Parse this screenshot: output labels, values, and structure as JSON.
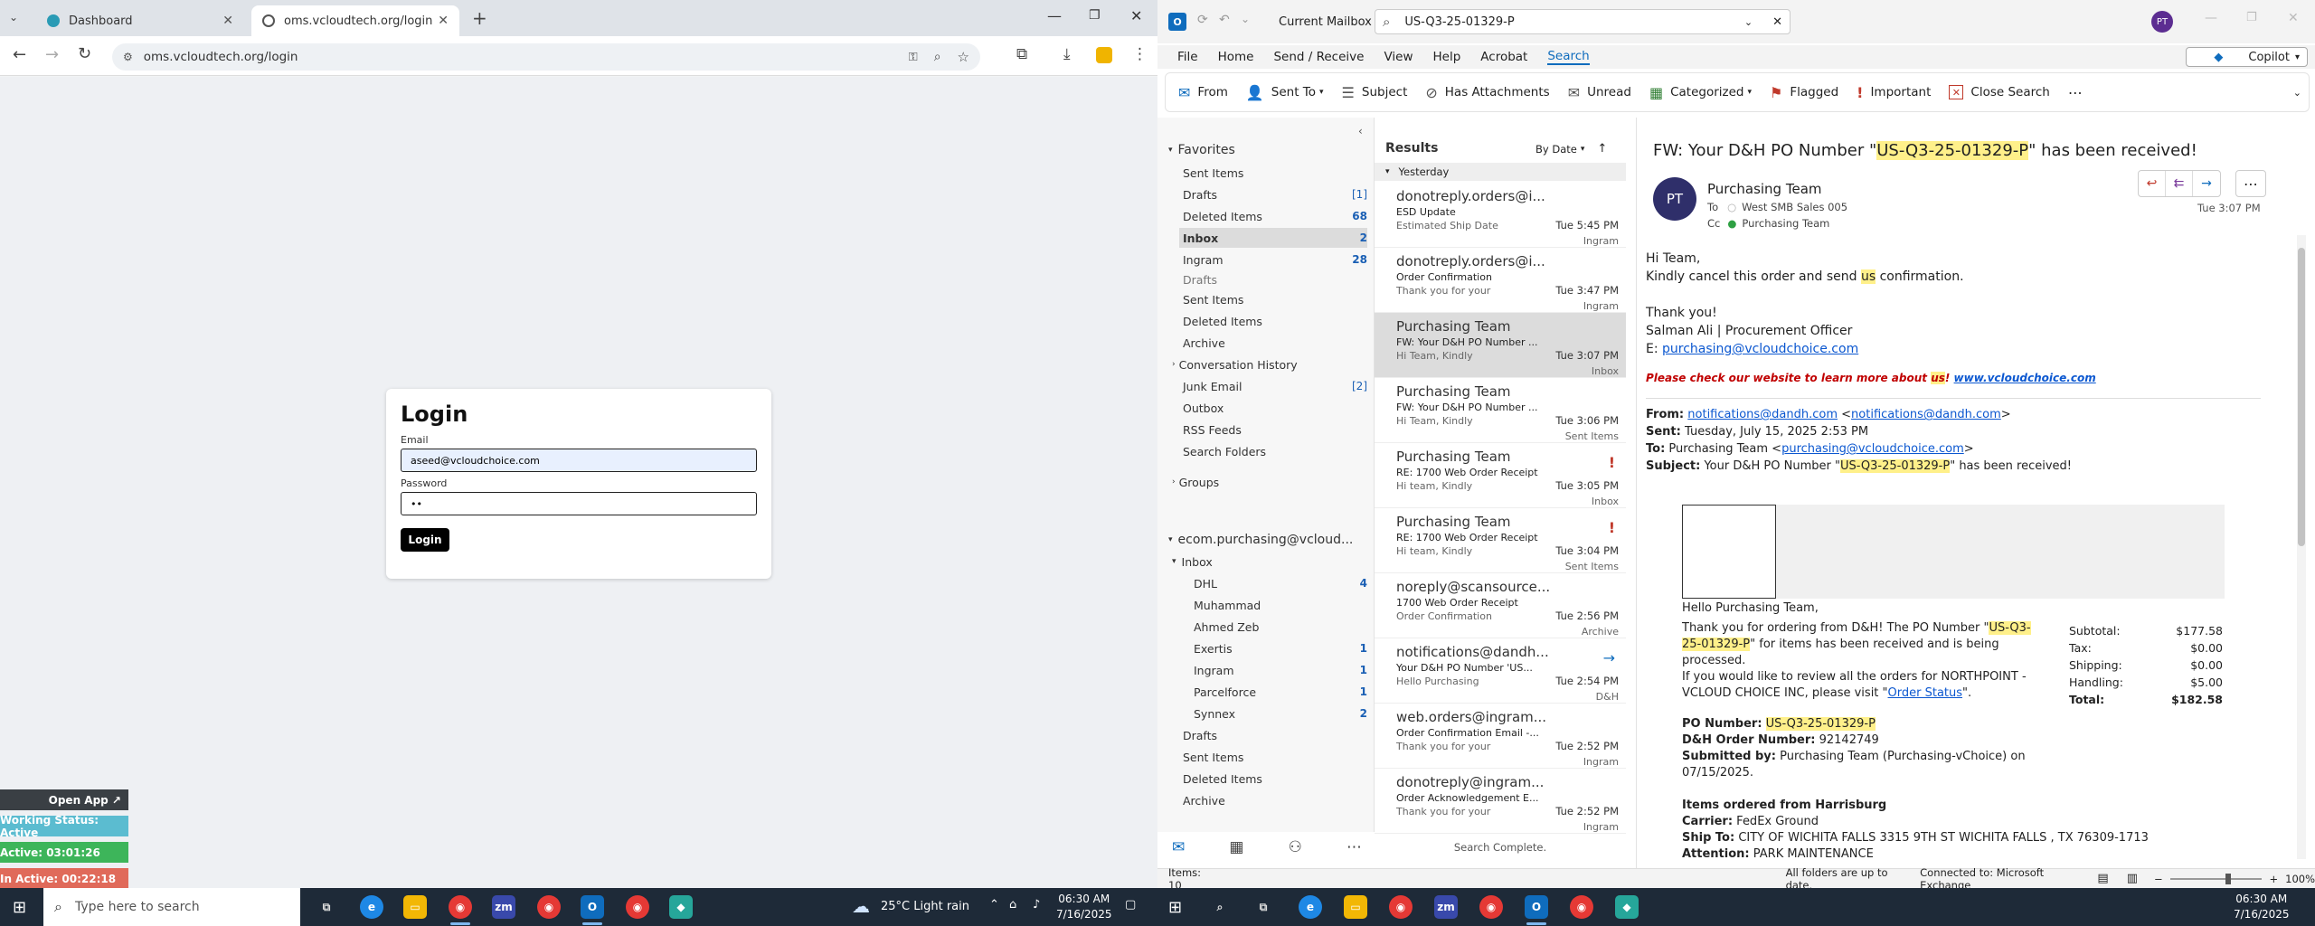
{
  "browser": {
    "tabs": [
      {
        "title": "Dashboard"
      },
      {
        "title": "oms.vcloudtech.org/login"
      }
    ],
    "url": "oms.vcloudtech.org/login",
    "login": {
      "heading": "Login",
      "email_label": "Email",
      "email_value": "aseed@vcloudchoice.com",
      "password_label": "Password",
      "password_value": "••",
      "button": "Login"
    },
    "widgets": {
      "open_app": "Open App ↗",
      "working_status": "Working Status: Active",
      "active_time": "Active: 03:01:26",
      "inactive_time": "In Active: 00:22:18"
    }
  },
  "outlook": {
    "mailbox_scope": "Current Mailbox",
    "search_value": "US-Q3-25-01329-P",
    "avatar_initials": "PT",
    "copilot": "Copilot",
    "menu": [
      "File",
      "Home",
      "Send / Receive",
      "View",
      "Help",
      "Acrobat",
      "Search"
    ],
    "ribbon": [
      "From",
      "Sent To",
      "Subject",
      "Has Attachments",
      "Unread",
      "Categorized",
      "Flagged",
      "Important",
      "Close Search"
    ],
    "nav": {
      "favorites_label": "Favorites",
      "favorites": [
        {
          "label": "Sent Items",
          "count": ""
        },
        {
          "label": "Drafts",
          "count": "[1]"
        },
        {
          "label": "Deleted Items",
          "count": "68"
        },
        {
          "label": "Inbox",
          "count": "2"
        },
        {
          "label": "Ingram",
          "count": "28"
        }
      ],
      "folders": [
        "Drafts",
        "Sent Items",
        "Deleted Items",
        "Archive",
        "Conversation History",
        "Junk Email",
        "Outbox",
        "RSS Feeds",
        "Search Folders",
        "Groups"
      ],
      "junk_count": "[2]",
      "account": "ecom.purchasing@vcloud...",
      "inbox_label": "Inbox",
      "subfolders": [
        {
          "label": "DHL",
          "count": "4"
        },
        {
          "label": "Muhammad",
          "count": ""
        },
        {
          "label": "Ahmed Zeb",
          "count": ""
        },
        {
          "label": "Exertis",
          "count": "1"
        },
        {
          "label": "Ingram",
          "count": "1"
        },
        {
          "label": "Parcelforce",
          "count": "1"
        },
        {
          "label": "Synnex",
          "count": "2"
        }
      ],
      "account_folders": [
        "Drafts",
        "Sent Items",
        "Deleted Items",
        "Archive"
      ]
    },
    "list": {
      "title": "Results",
      "sort": "By Date",
      "group": "Yesterday",
      "footer": "Search Complete.",
      "items": [
        {
          "from": "donotreply.orders@i...",
          "subject": "ESD Update",
          "preview": "Estimated Ship  Date",
          "time": "Tue 5:45 PM",
          "folder": "Ingram",
          "flag": ""
        },
        {
          "from": "donotreply.orders@i...",
          "subject": "Order Confirmation",
          "preview": "Thank you for  your",
          "time": "Tue 3:47 PM",
          "folder": "Ingram",
          "flag": ""
        },
        {
          "from": "Purchasing Team",
          "subject": "FW: Your D&H PO Number ...",
          "preview": "Hi Team,  Kindly",
          "time": "Tue 3:07 PM",
          "folder": "Inbox",
          "flag": ""
        },
        {
          "from": "Purchasing Team",
          "subject": "FW: Your D&H PO Number ...",
          "preview": "Hi Team,  Kindly",
          "time": "Tue 3:06 PM",
          "folder": "Sent Items",
          "flag": ""
        },
        {
          "from": "Purchasing Team",
          "subject": "RE: 1700 Web Order Receipt",
          "preview": "Hi team,  Kindly",
          "time": "Tue 3:05 PM",
          "folder": "Inbox",
          "flag": "!"
        },
        {
          "from": "Purchasing Team",
          "subject": "RE: 1700 Web Order Receipt",
          "preview": "Hi team,  Kindly",
          "time": "Tue 3:04 PM",
          "folder": "Sent Items",
          "flag": "!"
        },
        {
          "from": "noreply@scansource....",
          "subject": "1700 Web Order Receipt",
          "preview": "Order Confirmation",
          "time": "Tue 2:56 PM",
          "folder": "Archive",
          "flag": ""
        },
        {
          "from": "notifications@dandh....",
          "subject": "Your D&H PO Number 'US...",
          "preview": "Hello Purchasing",
          "time": "Tue 2:54 PM",
          "folder": "D&H",
          "flag": "→"
        },
        {
          "from": "web.orders@ingram...",
          "subject": "Order Confirmation Email -...",
          "preview": "Thank you for your",
          "time": "Tue 2:52 PM",
          "folder": "Ingram",
          "flag": ""
        },
        {
          "from": "donotreply@ingram...",
          "subject": "Order Acknowledgement E...",
          "preview": "Thank you for your",
          "time": "Tue 2:52 PM",
          "folder": "Ingram",
          "flag": ""
        }
      ]
    },
    "reading": {
      "subject_pre": "FW: Your D&H PO Number \"",
      "subject_hl": "US-Q3-25-01329-P",
      "subject_post": "\" has been received!",
      "sender": "Purchasing Team",
      "sender_initials": "PT",
      "to_label": "To",
      "to": "West SMB Sales 005",
      "cc_label": "Cc",
      "cc": "Purchasing Team",
      "date": "Tue 3:07 PM",
      "body": {
        "greet": "Hi Team,",
        "line1_pre": "Kindly cancel this order and send ",
        "line1_hl": "us",
        "line1_post": " confirmation.",
        "thanks": "Thank you!",
        "sig": "Salman Ali  | Procurement Officer",
        "email_prefix": "E: ",
        "email": "purchasing@vcloudchoice.com",
        "promo_pre": "Please check our website to learn more about ",
        "promo_hl": "us",
        "promo_post": "! ",
        "promo_link": "www.vcloudchoice.com"
      },
      "fwd": {
        "from_label": "From:",
        "from_addr": "notifications@dandh.com",
        "from_addr2": "notifications@dandh.com",
        "sent_label": "Sent:",
        "sent": "Tuesday, July 15, 2025 2:53 PM",
        "to_label": "To:",
        "to_name": "Purchasing Team <",
        "to_addr": "purchasing@vcloudchoice.com",
        "subj_label": "Subject:",
        "subj_pre": "Your D&H PO Number \"",
        "subj_hl": "US-Q3-25-01329-P",
        "subj_post": "\" has been received!"
      },
      "order": {
        "hello": "Hello Purchasing Team,",
        "p1_pre": "Thank you for ordering from D&H! The PO Number \"",
        "p1_hl": "US-Q3-25-01329-P",
        "p1_post": "\" for items has been received and is being processed.",
        "p2": "If you would like to review all the orders for NORTHPOINT - VCLOUD CHOICE INC, please visit \"",
        "p2_link": "Order Status",
        "p2_end": "\".",
        "po_label": "PO Number:",
        "po_value": "US-Q3-25-01329-P",
        "dh_label": "D&H Order Number:",
        "dh_value": "92142749",
        "sub_label": "Submitted by:",
        "sub_value": "Purchasing Team (Purchasing-vChoice) on 07/15/2025.",
        "items_label": "Items ordered from Harrisburg",
        "carrier_label": "Carrier:",
        "carrier_value": "FedEx Ground",
        "ship_label": "Ship To:",
        "ship_value": "CITY OF WICHITA FALLS  3315 9TH ST  WICHITA FALLS , TX 76309-1713",
        "attn_label": "Attention:",
        "attn_value": "PARK MAINTENANCE",
        "totals": [
          {
            "label": "Subtotal:",
            "value": "$177.58"
          },
          {
            "label": "Tax:",
            "value": "$0.00"
          },
          {
            "label": "Shipping:",
            "value": "$0.00"
          },
          {
            "label": "Handling:",
            "value": "$5.00"
          },
          {
            "label": "Total:",
            "value": "$182.58"
          }
        ]
      }
    },
    "status": {
      "items": "Items: 10",
      "sync": "All folders are up to date.",
      "connection": "Connected to: Microsoft Exchange",
      "zoom": "100%"
    }
  },
  "taskbar": {
    "search_placeholder": "Type here to search",
    "weather": "25°C  Light rain",
    "time_left": "06:30 AM",
    "date_left": "7/16/2025",
    "time_right": "06:30 AM",
    "date_right": "7/16/2025"
  }
}
